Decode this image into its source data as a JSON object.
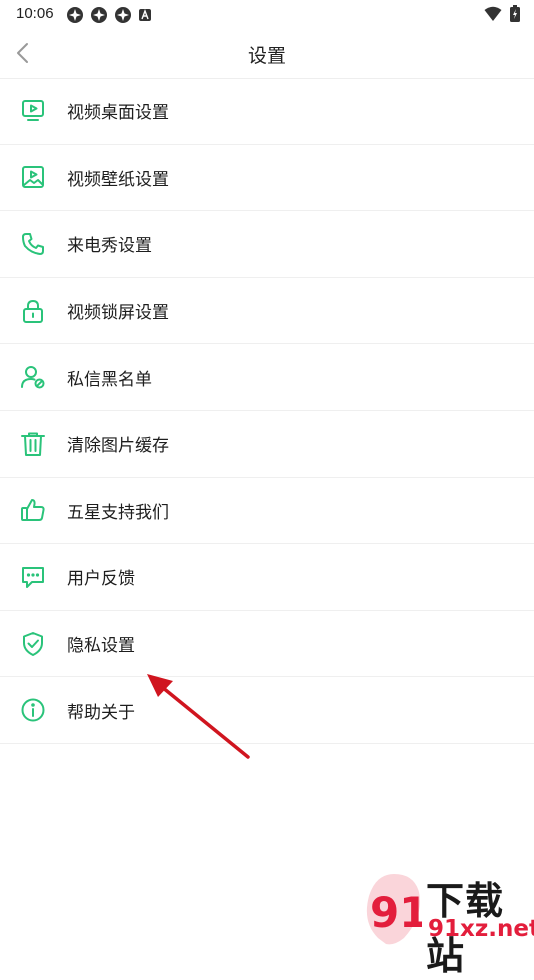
{
  "status_bar": {
    "time": "10:06",
    "notification_icons": [
      "app-icon",
      "app-icon",
      "app-icon",
      "a-icon"
    ],
    "right_icons": [
      "wifi-icon",
      "battery-charging-icon"
    ]
  },
  "header": {
    "title": "设置",
    "back_icon": "chevron-left-icon"
  },
  "accent_color": "#2ac37a",
  "menu": {
    "items": [
      {
        "label": "视频桌面设置",
        "icon": "video-desktop-icon"
      },
      {
        "label": "视频壁纸设置",
        "icon": "wallpaper-icon"
      },
      {
        "label": "来电秀设置",
        "icon": "phone-icon"
      },
      {
        "label": "视频锁屏设置",
        "icon": "lock-icon"
      },
      {
        "label": "私信黑名单",
        "icon": "user-block-icon"
      },
      {
        "label": "清除图片缓存",
        "icon": "trash-icon"
      },
      {
        "label": "五星支持我们",
        "icon": "thumbs-up-icon"
      },
      {
        "label": "用户反馈",
        "icon": "chat-icon"
      },
      {
        "label": "隐私设置",
        "icon": "shield-check-icon"
      },
      {
        "label": "帮助关于",
        "icon": "info-icon"
      }
    ]
  },
  "annotation": {
    "color": "#d0151f",
    "target": "隐私设置"
  },
  "watermark": {
    "logo_text": "91",
    "title": "下载站",
    "url": "91xz.net"
  }
}
